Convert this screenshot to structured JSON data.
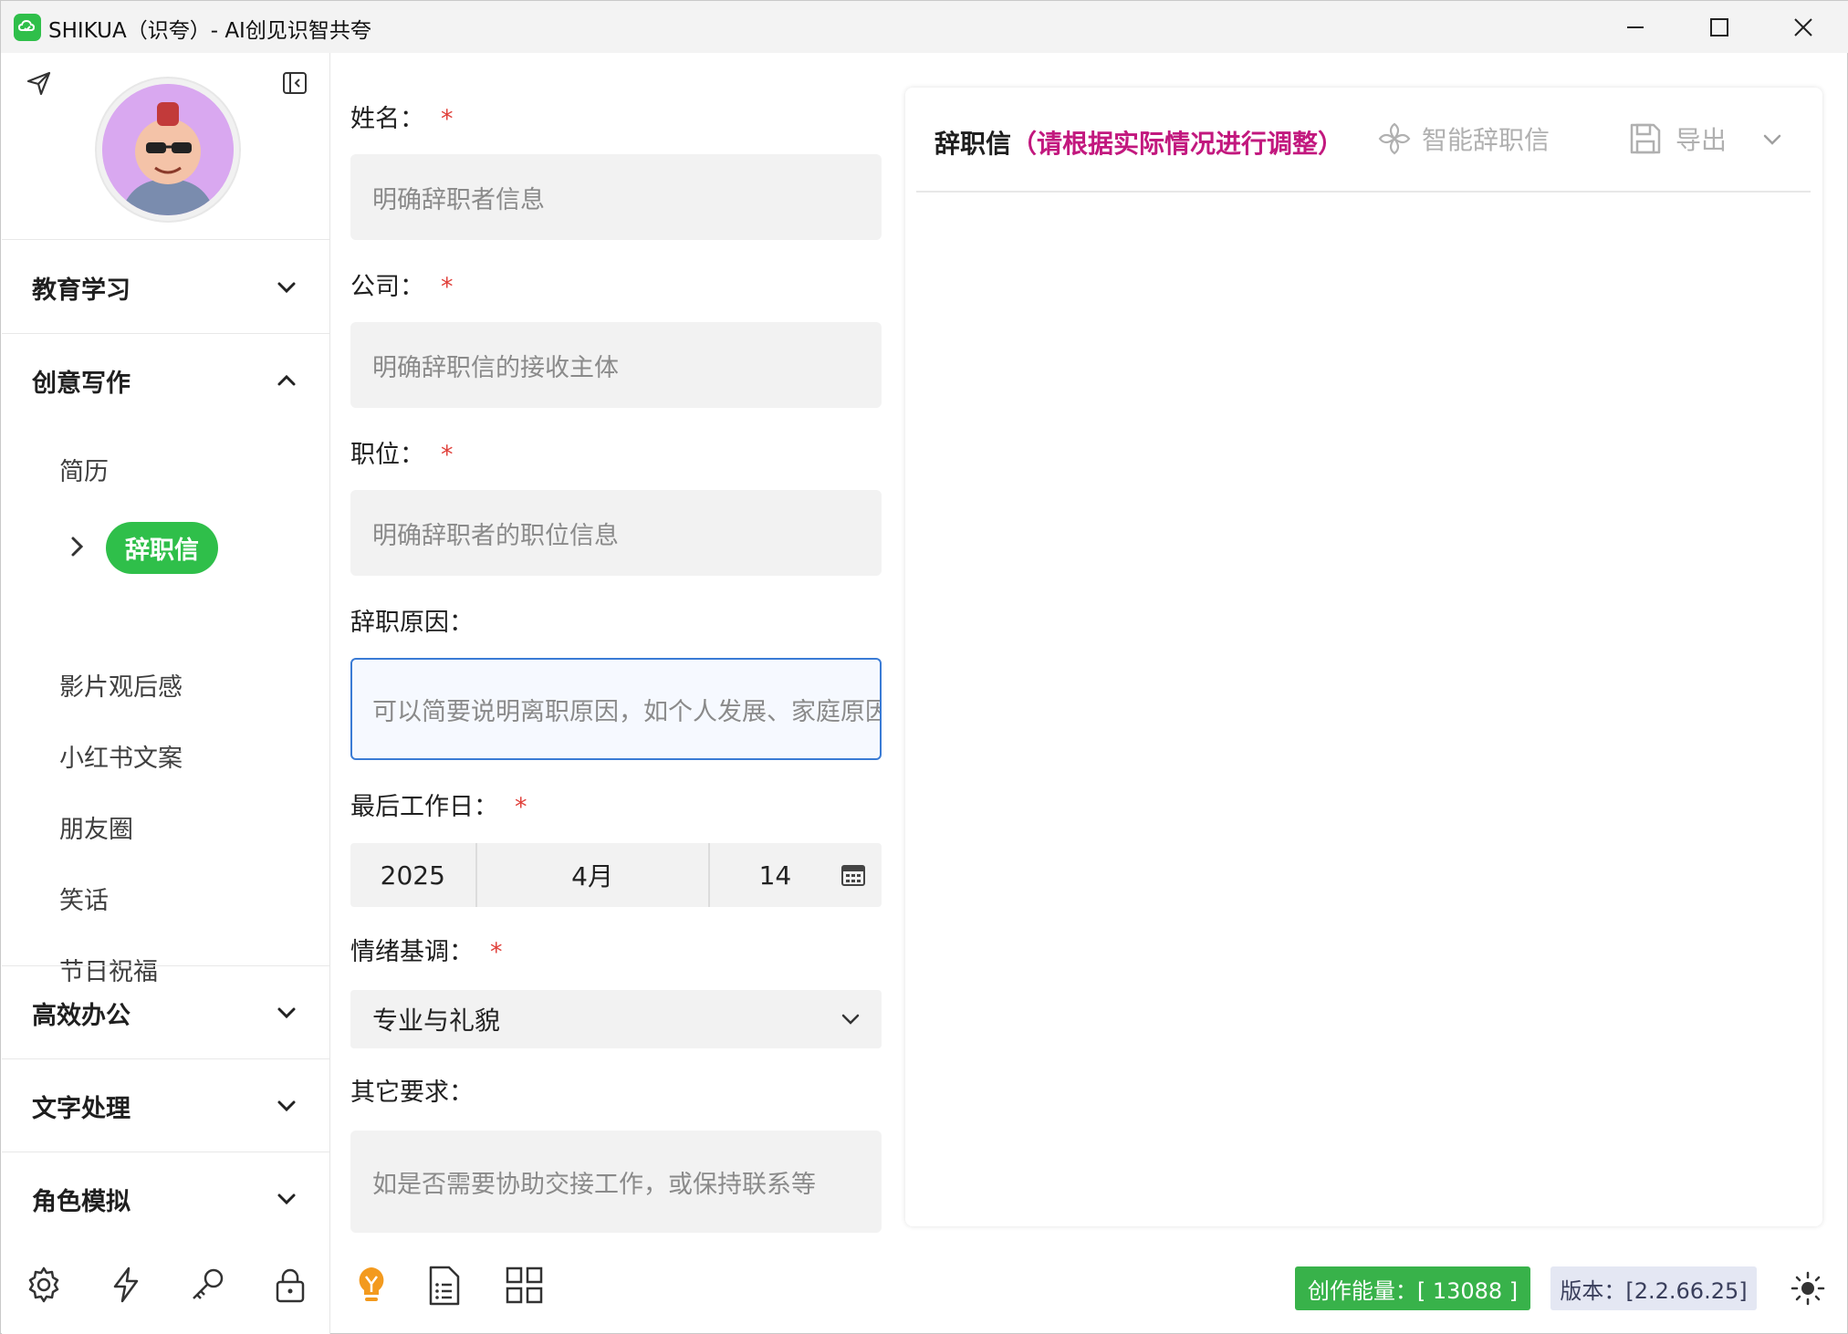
{
  "window": {
    "title": "SHIKUA（识夸）- AI创见识智共夸",
    "controls": [
      "minimize",
      "maximize",
      "close"
    ]
  },
  "sidebar": {
    "categories": [
      {
        "label": "教育学习",
        "expanded": false
      },
      {
        "label": "创意写作",
        "expanded": true
      },
      {
        "label": "高效办公",
        "expanded": false
      },
      {
        "label": "文字处理",
        "expanded": false
      },
      {
        "label": "角色模拟",
        "expanded": false
      }
    ],
    "creative_items": [
      "简历",
      "辞职信",
      "影片观后感",
      "小红书文案",
      "朋友圈",
      "笑话",
      "节日祝福"
    ],
    "active_item": "辞职信",
    "bottom_icons": [
      "settings-icon",
      "lightning-icon",
      "key-icon",
      "lock-icon"
    ]
  },
  "form": {
    "name": {
      "label": "姓名：",
      "required": true,
      "placeholder": "明确辞职者信息"
    },
    "company": {
      "label": "公司：",
      "required": true,
      "placeholder": "明确辞职信的接收主体"
    },
    "position": {
      "label": "职位：",
      "required": true,
      "placeholder": "明确辞职者的职位信息"
    },
    "reason": {
      "label": "辞职原因：",
      "required": false,
      "placeholder": "可以简要说明离职原因，如个人发展、家庭原因等"
    },
    "last_day": {
      "label": "最后工作日：",
      "required": true,
      "year": "2025",
      "month": "4月",
      "day": "14"
    },
    "tone": {
      "label": "情绪基调：",
      "required": true,
      "value": "专业与礼貌"
    },
    "other": {
      "label": "其它要求：",
      "required": false,
      "placeholder": "如是否需要协助交接工作，或保持联系等"
    },
    "required_mark": "*",
    "toolbar_icons": [
      "lightbulb-icon",
      "document-list-icon",
      "grid-icon"
    ]
  },
  "panel": {
    "title": "辞职信",
    "hint": "（请根据实际情况进行调整）",
    "smart_button": "智能辞职信",
    "export_button": "导出"
  },
  "status": {
    "energy": "创作能量：[ 13088 ]",
    "version": "版本：[2.2.66.25]"
  },
  "colors": {
    "accent_green": "#2fbf4a",
    "hint_magenta": "#c2187e",
    "required_red": "#e0413b",
    "focus_blue": "#3a7bd5"
  }
}
